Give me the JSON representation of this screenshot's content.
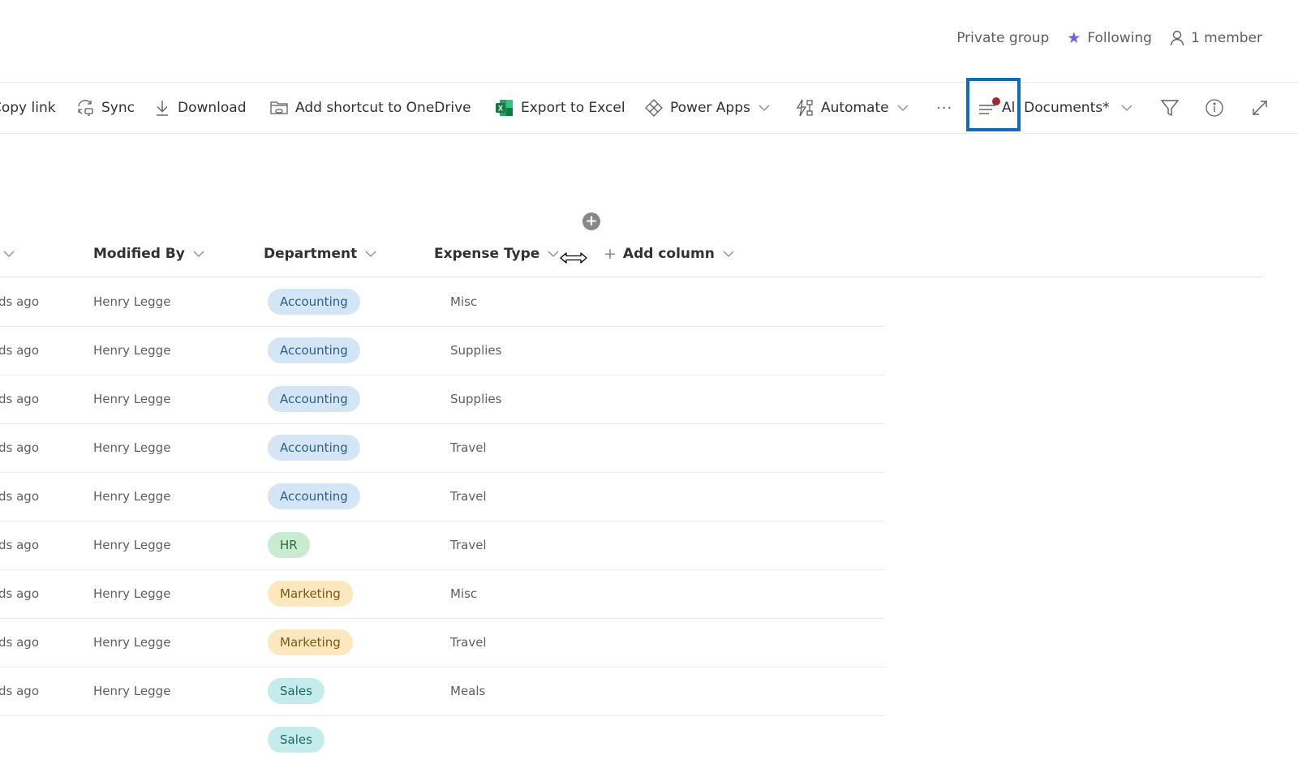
{
  "group_info": {
    "privacy": "Private group",
    "following_label": "Following",
    "members_label": "1 member"
  },
  "toolbar": {
    "copy_link": "Copy link",
    "sync": "Sync",
    "download": "Download",
    "add_shortcut": "Add shortcut to OneDrive",
    "export_excel": "Export to Excel",
    "power_apps": "Power Apps",
    "automate": "Automate",
    "more": "···",
    "view_name": "All Documents*",
    "view_prefix": "Al",
    "view_suffix": "Documents*"
  },
  "columns": {
    "modified": "",
    "modified_by": "Modified By",
    "department": "Department",
    "expense_type": "Expense Type",
    "add_column": "Add column"
  },
  "department_colors": {
    "Accounting": {
      "bg": "#d4e6f5",
      "fg": "#2b5f8a"
    },
    "HR": {
      "bg": "#c9ebd1",
      "fg": "#2f6b3b"
    },
    "Marketing": {
      "bg": "#fde7bf",
      "fg": "#7a5a12"
    },
    "Sales": {
      "bg": "#c5ecec",
      "fg": "#1f6666"
    }
  },
  "rows": [
    {
      "modified": "ds ago",
      "modified_by": "Henry Legge",
      "department": "Accounting",
      "expense_type": "Misc"
    },
    {
      "modified": "ds ago",
      "modified_by": "Henry Legge",
      "department": "Accounting",
      "expense_type": "Supplies"
    },
    {
      "modified": "ds ago",
      "modified_by": "Henry Legge",
      "department": "Accounting",
      "expense_type": "Supplies"
    },
    {
      "modified": "ds ago",
      "modified_by": "Henry Legge",
      "department": "Accounting",
      "expense_type": "Travel"
    },
    {
      "modified": "ds ago",
      "modified_by": "Henry Legge",
      "department": "Accounting",
      "expense_type": "Travel"
    },
    {
      "modified": "ds ago",
      "modified_by": "Henry Legge",
      "department": "HR",
      "expense_type": "Travel"
    },
    {
      "modified": "ds ago",
      "modified_by": "Henry Legge",
      "department": "Marketing",
      "expense_type": "Misc"
    },
    {
      "modified": "ds ago",
      "modified_by": "Henry Legge",
      "department": "Marketing",
      "expense_type": "Travel"
    },
    {
      "modified": "ds ago",
      "modified_by": "Henry Legge",
      "department": "Sales",
      "expense_type": "Meals"
    },
    {
      "modified": "",
      "modified_by": "",
      "department": "Sales",
      "expense_type": ""
    }
  ]
}
